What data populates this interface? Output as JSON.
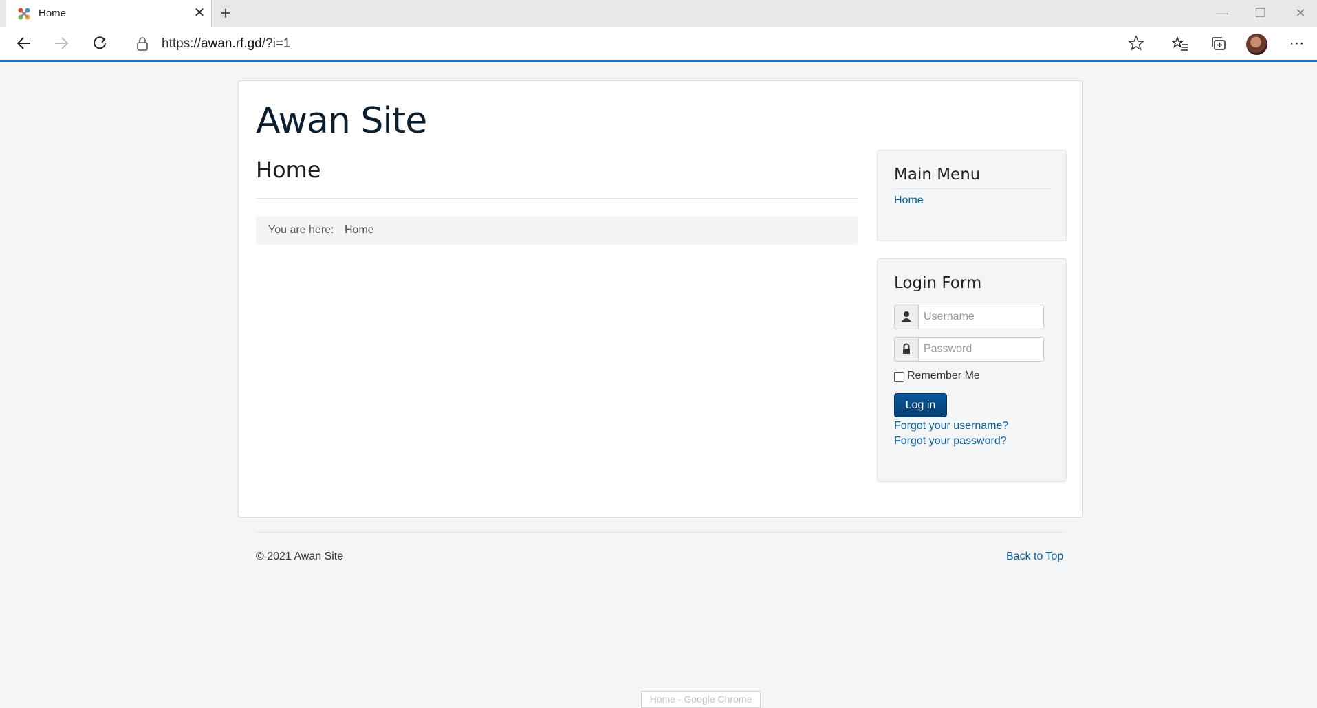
{
  "browser": {
    "tab_title": "Home",
    "tab_close_glyph": "✕",
    "new_tab_glyph": "+",
    "url_prefix": "https://",
    "url_host": "awan.rf.gd",
    "url_path": "/?i=1",
    "window_buttons": [
      "—",
      "❐",
      "✕"
    ],
    "tooltip": "Home - Google Chrome",
    "icons": [
      "joomla-favicon-icon",
      "back-icon",
      "forward-icon",
      "reload-icon",
      "lock-icon",
      "favorite-star-icon",
      "favorites-icon",
      "collections-icon",
      "profile-avatar",
      "more-icon"
    ]
  },
  "site": {
    "title": "Awan Site",
    "content_title": "Home",
    "breadcrumb": {
      "label": "You are here:",
      "current": "Home"
    }
  },
  "main_menu": {
    "title": "Main Menu",
    "items": [
      "Home"
    ]
  },
  "login_form": {
    "title": "Login Form",
    "username_placeholder": "Username",
    "password_placeholder": "Password",
    "remember_label": "Remember Me",
    "remember_checked": false,
    "login_button": "Log in",
    "forgot_username": "Forgot your username?",
    "forgot_password": "Forgot your password?"
  },
  "footer": {
    "copyright": "© 2021 Awan Site",
    "back_to_top": "Back to Top"
  },
  "colors": {
    "accent": "#1a75d2",
    "link": "#0b5f99",
    "button": "#063f73",
    "page_bg": "#f4f5f7"
  }
}
